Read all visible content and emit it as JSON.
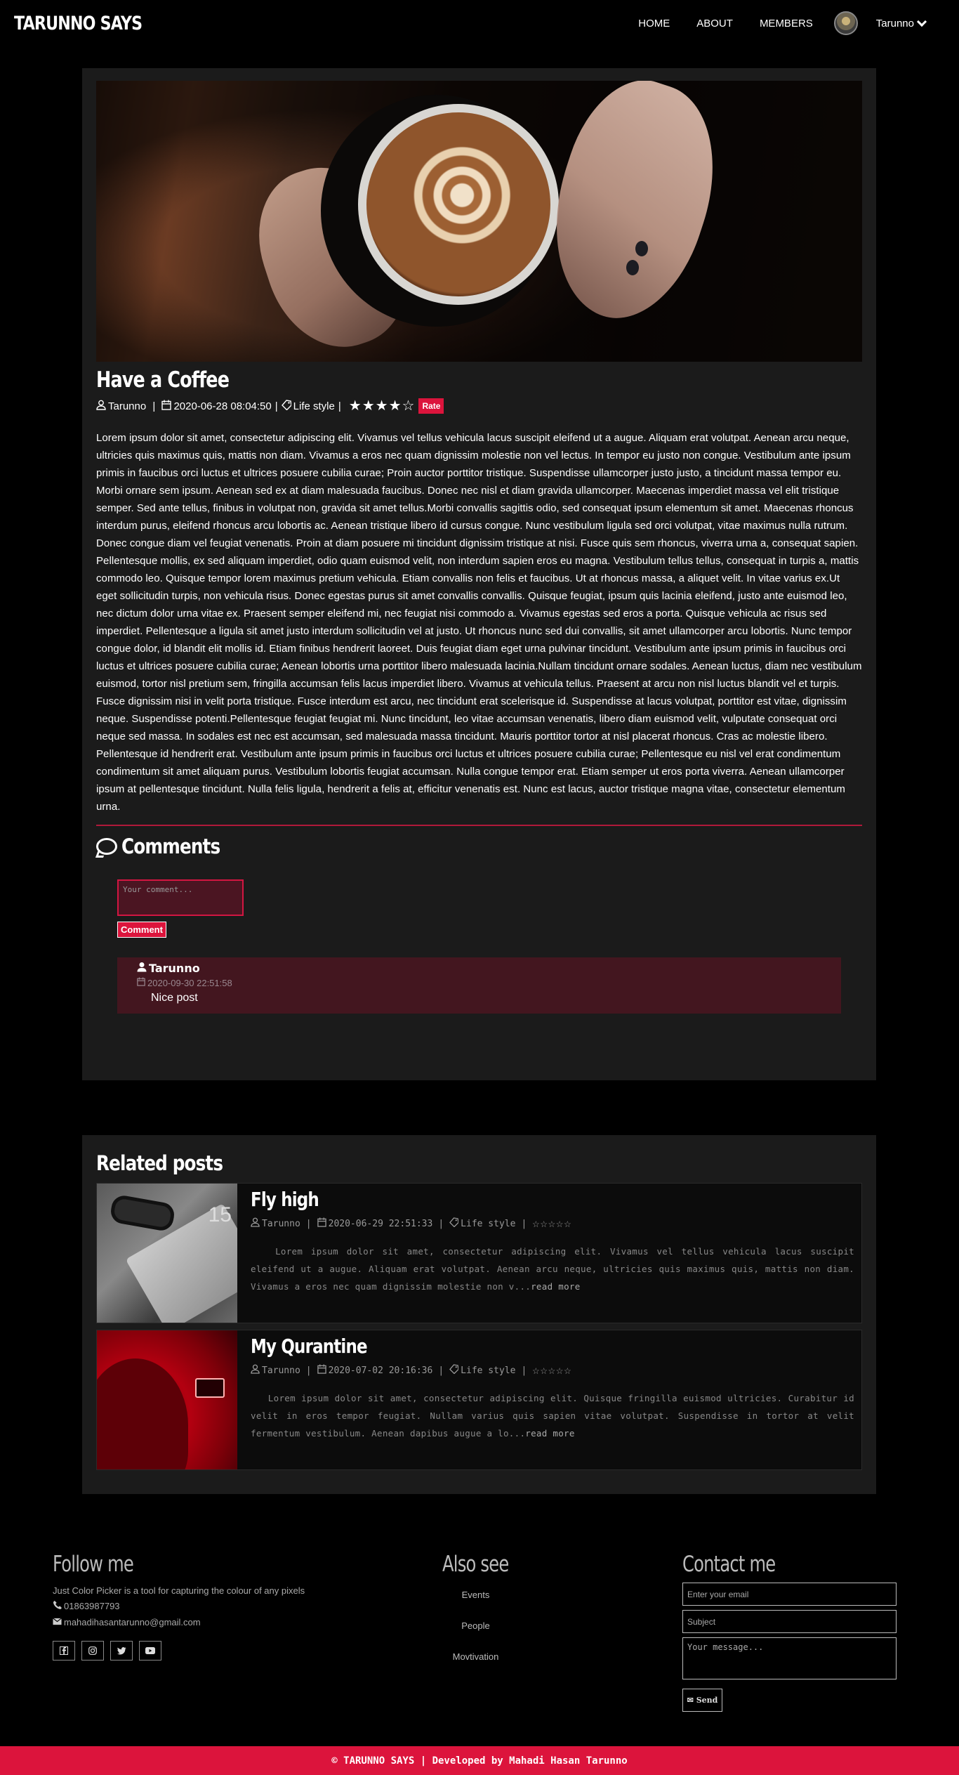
{
  "nav": {
    "brand": "TARUNNO SAYS",
    "links": [
      "HOME",
      "ABOUT",
      "MEMBERS"
    ],
    "user": "Tarunno"
  },
  "post": {
    "title": "Have a Coffee",
    "author": "Tarunno",
    "date": "2020-06-28 08:04:50",
    "category": "Life style",
    "rating": 4,
    "rating_max": 5,
    "rate_label": "Rate",
    "body": "Lorem ipsum dolor sit amet, consectetur adipiscing elit. Vivamus vel tellus vehicula lacus suscipit eleifend ut a augue. Aliquam erat volutpat. Aenean arcu neque, ultricies quis maximus quis, mattis non diam. Vivamus a eros nec quam dignissim molestie non vel lectus. In tempor eu justo non congue. Vestibulum ante ipsum primis in faucibus orci luctus et ultrices posuere cubilia curae; Proin auctor porttitor tristique. Suspendisse ullamcorper justo justo, a tincidunt massa tempor eu. Morbi ornare sem ipsum. Aenean sed ex at diam malesuada faucibus. Donec nec nisl et diam gravida ullamcorper. Maecenas imperdiet massa vel elit tristique semper. Sed ante tellus, finibus in volutpat non, gravida sit amet tellus.Morbi convallis sagittis odio, sed consequat ipsum elementum sit amet. Maecenas rhoncus interdum purus, eleifend rhoncus arcu lobortis ac. Aenean tristique libero id cursus congue. Nunc vestibulum ligula sed orci volutpat, vitae maximus nulla rutrum. Donec congue diam vel feugiat venenatis. Proin at diam posuere mi tincidunt dignissim tristique at nisi. Fusce quis sem rhoncus, viverra urna a, consequat sapien. Pellentesque mollis, ex sed aliquam imperdiet, odio quam euismod velit, non interdum sapien eros eu magna. Vestibulum tellus tellus, consequat in turpis a, mattis commodo leo. Quisque tempor lorem maximus pretium vehicula. Etiam convallis non felis et faucibus. Ut at rhoncus massa, a aliquet velit. In vitae varius ex.Ut eget sollicitudin turpis, non vehicula risus. Donec egestas purus sit amet convallis convallis. Quisque feugiat, ipsum quis lacinia eleifend, justo ante euismod leo, nec dictum dolor urna vitae ex. Praesent semper eleifend mi, nec feugiat nisi commodo a. Vivamus egestas sed eros a porta. Quisque vehicula ac risus sed imperdiet. Pellentesque a ligula sit amet justo interdum sollicitudin vel at justo. Ut rhoncus nunc sed dui convallis, sit amet ullamcorper arcu lobortis. Nunc tempor congue dolor, id blandit elit mollis id. Etiam finibus hendrerit laoreet. Duis feugiat diam eget urna pulvinar tincidunt. Vestibulum ante ipsum primis in faucibus orci luctus et ultrices posuere cubilia curae; Aenean lobortis urna porttitor libero malesuada lacinia.Nullam tincidunt ornare sodales. Aenean luctus, diam nec vestibulum euismod, tortor nisl pretium sem, fringilla accumsan felis lacus imperdiet libero. Vivamus at vehicula tellus. Praesent at arcu non nisl luctus blandit vel et turpis. Fusce dignissim nisi in velit porta tristique. Fusce interdum est arcu, nec tincidunt erat scelerisque id. Suspendisse at lacus volutpat, porttitor est vitae, dignissim neque. Suspendisse potenti.Pellentesque feugiat feugiat mi. Nunc tincidunt, leo vitae accumsan venenatis, libero diam euismod velit, vulputate consequat orci neque sed massa. In sodales est nec est accumsan, sed malesuada massa tincidunt. Mauris porttitor tortor at nisl placerat rhoncus. Cras ac molestie libero. Pellentesque id hendrerit erat. Vestibulum ante ipsum primis in faucibus orci luctus et ultrices posuere cubilia curae; Pellentesque eu nisl vel erat condimentum condimentum sit amet aliquam purus. Vestibulum lobortis feugiat accumsan. Nulla congue tempor erat. Etiam semper ut eros porta viverra. Aenean ullamcorper ipsum at pellentesque tincidunt. Nulla felis ligula, hendrerit a felis at, efficitur venenatis est. Nunc est lacus, auctor tristique magna vitae, consectetur elementum urna."
  },
  "comments": {
    "heading": "Comments",
    "placeholder": "Your comment...",
    "button": "Comment",
    "items": [
      {
        "author": "Tarunno",
        "date": "2020-09-30 22:51:58",
        "text": "Nice post"
      }
    ]
  },
  "related": {
    "heading": "Related posts",
    "read_more": "read more",
    "items": [
      {
        "title": "Fly high",
        "author": "Tarunno",
        "date": "2020-06-29 22:51:33",
        "category": "Life style",
        "rating": 0,
        "excerpt": "Lorem ipsum dolor sit amet, consectetur adipiscing elit. Vivamus vel tellus vehicula lacus suscipit eleifend ut a augue. Aliquam erat volutpat. Aenean arcu neque, ultricies quis maximus quis, mattis non diam. Vivamus a eros nec quam dignissim molestie non v..."
      },
      {
        "title": "My Qurantine",
        "author": "Tarunno",
        "date": "2020-07-02 20:16:36",
        "category": "Life style",
        "rating": 0,
        "excerpt": "Lorem ipsum dolor sit amet, consectetur adipiscing elit. Quisque fringilla euismod ultricies. Curabitur id velit in eros tempor feugiat. Nullam varius quis sapien vitae volutpat. Suspendisse in tortor at velit fermentum vestibulum. Aenean dapibus augue a lo..."
      }
    ]
  },
  "footer": {
    "follow": {
      "title": "Follow me",
      "desc": "Just Color Picker is a tool for capturing the colour of any pixels",
      "phone": "01863987793",
      "email": "mahadihasantarunno@gmail.com",
      "socials": [
        "facebook-icon",
        "instagram-icon",
        "twitter-icon",
        "youtube-icon"
      ]
    },
    "also": {
      "title": "Also see",
      "links": [
        "Events",
        "People",
        "Movtivation"
      ]
    },
    "contact": {
      "title": "Contact me",
      "email_placeholder": "Enter your email",
      "subject_placeholder": "Subject",
      "message_placeholder": "Your message...",
      "send": "Send"
    },
    "copyright": "© TARUNNO SAYS | Developed by Mahadi Hasan Tarunno"
  },
  "colors": {
    "accent": "#dc143c",
    "card": "#1b1b1b",
    "comment_bg": "#43161f"
  }
}
